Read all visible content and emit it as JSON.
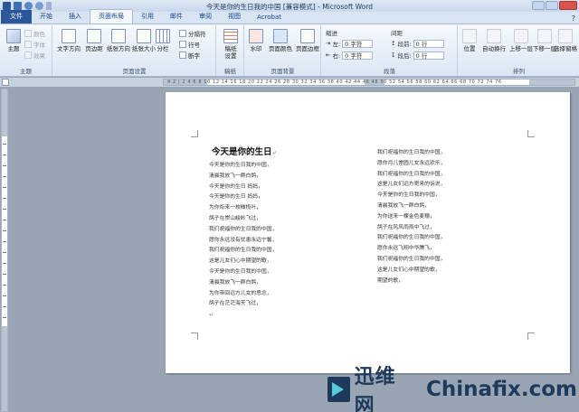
{
  "window": {
    "title": "今天是你的生日我的中国 [兼容模式] - Microsoft Word"
  },
  "tabs": [
    {
      "label": "文件"
    },
    {
      "label": "开始"
    },
    {
      "label": "插入"
    },
    {
      "label": "页面布局"
    },
    {
      "label": "引用"
    },
    {
      "label": "邮件"
    },
    {
      "label": "审阅"
    },
    {
      "label": "视图"
    },
    {
      "label": "Acrobat"
    }
  ],
  "ribbon": {
    "theme": {
      "label": "主题",
      "button": "主题",
      "colors": "颜色",
      "fonts": "字体",
      "effects": "效果"
    },
    "page_setup": {
      "label": "页面设置",
      "text_direction": "文字方向",
      "margins": "页边距",
      "orientation": "纸张方向",
      "size": "纸张大小",
      "columns": "分栏",
      "breaks": "分隔符",
      "line_numbers": "行号",
      "hyphenation": "断字"
    },
    "draft": {
      "label": "稿纸",
      "button_line1": "稿纸",
      "button_line2": "设置"
    },
    "page_background": {
      "label": "页面背景",
      "watermark": "水印",
      "page_color": "页面颜色",
      "page_borders": "页面边框"
    },
    "paragraph": {
      "label": "段落",
      "indent_title": "缩进",
      "spacing_title": "间距",
      "indent_left_label": "左:",
      "indent_left_value": "0 字符",
      "indent_right_label": "右:",
      "indent_right_value": "0 字符",
      "spacing_before_label": "段前:",
      "spacing_before_value": "0 行",
      "spacing_after_label": "段后:",
      "spacing_after_value": "0 行"
    },
    "arrange": {
      "label": "排列",
      "position": "位置",
      "wrap_text": "自动换行",
      "bring_forward": "上移一层",
      "send_backward": "下移一层",
      "selection_pane": "选择窗格"
    }
  },
  "ruler": {
    "text": "4  2  |  2  4  6  8  10  12  14  16  18  20  22  24  26  28  30  32  34  36  38  40  42  44  46  48  50  52  54  56  58  60  62  64  66  68  70  72  74  76"
  },
  "document": {
    "title": "今天是你的生日",
    "left_column": [
      "今天是你的生日我的中国，",
      "清晨我放飞一群白鸽，",
      "今天是你的生日 妈妈，",
      "今天是你的生日 妈妈，",
      "为你衔来一枚橄榄叶，",
      "鸽子在崇山峻岭飞过，",
      "我们祝福你的生日我的中国，",
      "愿你永远没有忧患永远宁馨，",
      "我们祝福你的生日我的中国，",
      "这是儿女们心中期望的歌，",
      "今天是你的生日我的中国，",
      "清晨我放飞一群白鸽，",
      "为你带回远方儿女的思念，",
      "鸽子在茫茫海天飞过，"
    ],
    "right_column": [
      "我们祝福你的生日我的中国，",
      "愿你月儿常圆儿女永远欢乐，",
      "我们祝福你的生日我的中国，",
      "这是儿女们远方寄来的诉说，",
      "今天是你的生日我的中国，",
      "清晨我放飞一群白鸽，",
      "为你送来一棵金色麦穗，",
      "鸽子在风风雨雨中飞过，",
      "我们祝福你的生日我的中国，",
      "愿你永远飞翔中华腾飞，",
      "我们祝福你的生日我的中国，",
      "这是儿女们心中期望的歌，",
      "期望的歌，"
    ]
  },
  "watermark": {
    "cn": "迅维网",
    "en": "Chinafix.com"
  },
  "colors": {
    "file_tab": "#2b579a",
    "app_frame": "#9aa5b3",
    "watermark": "#1d3a5c",
    "watermark_accent": "#59c8d8"
  }
}
